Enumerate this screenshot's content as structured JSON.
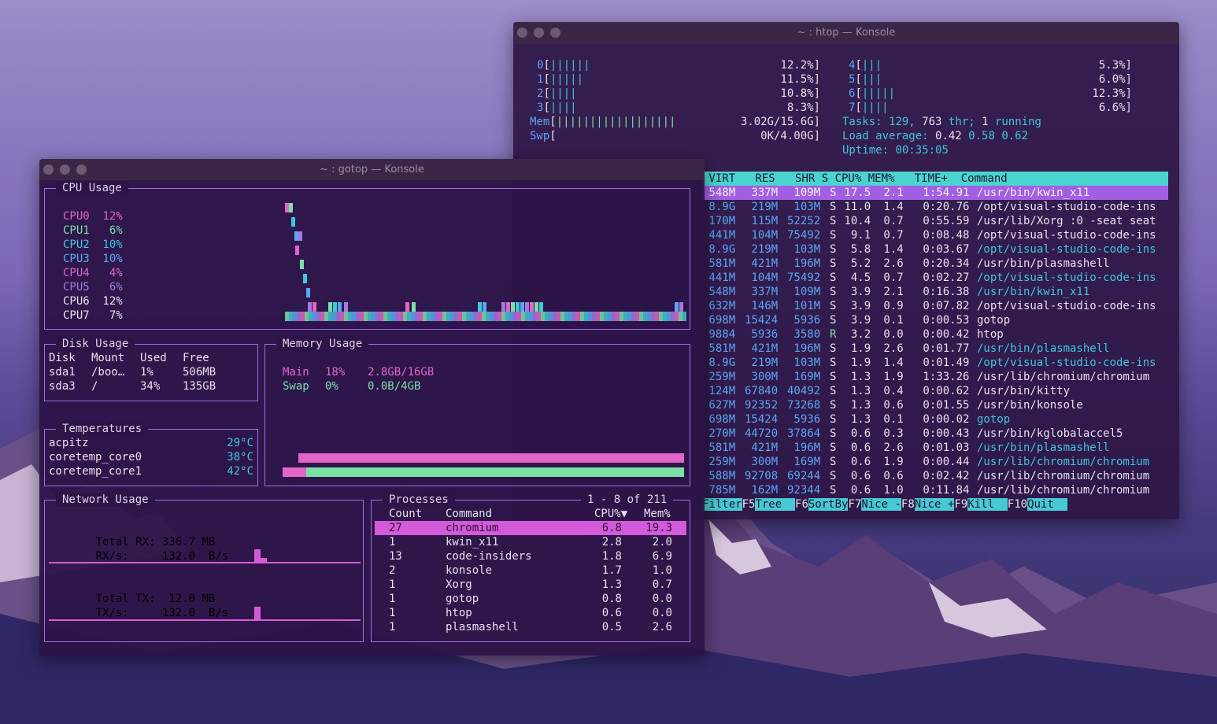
{
  "htop": {
    "title": "~ : htop — Konsole",
    "cpus_left": [
      {
        "id": "0",
        "bars": "||||||",
        "pct": "12.2%]"
      },
      {
        "id": "1",
        "bars": "|||||",
        "pct": "11.5%]"
      },
      {
        "id": "2",
        "bars": "||||",
        "pct": "10.8%]"
      },
      {
        "id": "3",
        "bars": "||||",
        "pct": "8.3%]"
      }
    ],
    "cpus_right": [
      {
        "id": "4",
        "bars": "|||",
        "pct": "5.3%]"
      },
      {
        "id": "5",
        "bars": "|||",
        "pct": "6.0%]"
      },
      {
        "id": "6",
        "bars": "|||||",
        "pct": "12.3%]"
      },
      {
        "id": "7",
        "bars": "||||",
        "pct": "6.6%]"
      }
    ],
    "mem": {
      "label": "Mem",
      "bars": "||||||||||||||||||",
      "value": "3.02G/15.6G]"
    },
    "swp": {
      "label": "Swp",
      "value": "0K/4.00G]"
    },
    "tasks": {
      "label": "Tasks:",
      "count": "129,",
      "thr": "763",
      "thr_label": "thr;",
      "running": "1",
      "running_label": "running"
    },
    "load": {
      "label": "Load average:",
      "v1": "0.42",
      "v2": "0.58",
      "v3": "0.62"
    },
    "uptime": {
      "label": "Uptime:",
      "value": "00:35:05"
    },
    "header": " VIRT   RES   SHR S CPU% MEM%   TIME+  Command",
    "rows": [
      {
        "virt": "548M",
        "res": "337M",
        "shr": "109M",
        "s": "S",
        "cpu": "17.5",
        "mem": "2.1",
        "time": "1:54.91",
        "cmd": "/usr/bin/kwin_x11",
        "sel": true
      },
      {
        "virt": "8.9G",
        "res": "219M",
        "shr": "103M",
        "s": "S",
        "cpu": "11.0",
        "mem": "1.4",
        "time": "0:20.76",
        "cmd": "/opt/visual-studio-code-ins"
      },
      {
        "virt": "170M",
        "res": "115M",
        "shr": "52252",
        "s": "S",
        "cpu": "10.4",
        "mem": "0.7",
        "time": "0:55.59",
        "cmd": "/usr/lib/Xorg :0 -seat seat"
      },
      {
        "virt": "441M",
        "res": "104M",
        "shr": "75492",
        "s": "S",
        "cpu": "9.1",
        "mem": "0.7",
        "time": "0:08.48",
        "cmd": "/opt/visual-studio-code-ins"
      },
      {
        "virt": "8.9G",
        "res": "219M",
        "shr": "103M",
        "s": "S",
        "cpu": "5.8",
        "mem": "1.4",
        "time": "0:03.67",
        "cmd": "/opt/visual-studio-code-ins",
        "thread": true
      },
      {
        "virt": "581M",
        "res": "421M",
        "shr": "196M",
        "s": "S",
        "cpu": "5.2",
        "mem": "2.6",
        "time": "0:20.34",
        "cmd": "/usr/bin/plasmashell"
      },
      {
        "virt": "441M",
        "res": "104M",
        "shr": "75492",
        "s": "S",
        "cpu": "4.5",
        "mem": "0.7",
        "time": "0:02.27",
        "cmd": "/opt/visual-studio-code-ins",
        "thread": true
      },
      {
        "virt": "548M",
        "res": "337M",
        "shr": "109M",
        "s": "S",
        "cpu": "3.9",
        "mem": "2.1",
        "time": "0:16.38",
        "cmd": "/usr/bin/kwin_x11",
        "thread": true
      },
      {
        "virt": "632M",
        "res": "146M",
        "shr": "101M",
        "s": "S",
        "cpu": "3.9",
        "mem": "0.9",
        "time": "0:07.82",
        "cmd": "/opt/visual-studio-code-ins"
      },
      {
        "virt": "698M",
        "res": "15424",
        "shr": "5936",
        "s": "S",
        "cpu": "3.9",
        "mem": "0.1",
        "time": "0:00.53",
        "cmd": "gotop"
      },
      {
        "virt": "9884",
        "res": "5936",
        "shr": "3580",
        "s": "R",
        "cpu": "3.2",
        "mem": "0.0",
        "time": "0:00.42",
        "cmd": "htop"
      },
      {
        "virt": "581M",
        "res": "421M",
        "shr": "196M",
        "s": "S",
        "cpu": "1.9",
        "mem": "2.6",
        "time": "0:01.77",
        "cmd": "/usr/bin/plasmashell",
        "thread": true
      },
      {
        "virt": "8.9G",
        "res": "219M",
        "shr": "103M",
        "s": "S",
        "cpu": "1.9",
        "mem": "1.4",
        "time": "0:01.49",
        "cmd": "/opt/visual-studio-code-ins",
        "thread": true
      },
      {
        "virt": "259M",
        "res": "300M",
        "shr": "169M",
        "s": "S",
        "cpu": "1.3",
        "mem": "1.9",
        "time": "1:33.26",
        "cmd": "/usr/lib/chromium/chromium"
      },
      {
        "virt": "124M",
        "res": "67840",
        "shr": "40492",
        "s": "S",
        "cpu": "1.3",
        "mem": "0.4",
        "time": "0:00.62",
        "cmd": "/usr/bin/kitty"
      },
      {
        "virt": "627M",
        "res": "92352",
        "shr": "73268",
        "s": "S",
        "cpu": "1.3",
        "mem": "0.6",
        "time": "0:01.55",
        "cmd": "/usr/bin/konsole"
      },
      {
        "virt": "698M",
        "res": "15424",
        "shr": "5936",
        "s": "S",
        "cpu": "1.3",
        "mem": "0.1",
        "time": "0:00.02",
        "cmd": "gotop",
        "thread": true
      },
      {
        "virt": "270M",
        "res": "44720",
        "shr": "37864",
        "s": "S",
        "cpu": "0.6",
        "mem": "0.3",
        "time": "0:00.43",
        "cmd": "/usr/bin/kglobalaccel5"
      },
      {
        "virt": "581M",
        "res": "421M",
        "shr": "196M",
        "s": "S",
        "cpu": "0.6",
        "mem": "2.6",
        "time": "0:01.03",
        "cmd": "/usr/bin/plasmashell",
        "thread": true
      },
      {
        "virt": "259M",
        "res": "300M",
        "shr": "169M",
        "s": "S",
        "cpu": "0.6",
        "mem": "1.9",
        "time": "0:00.44",
        "cmd": "/usr/lib/chromium/chromium",
        "thread": true
      },
      {
        "virt": "588M",
        "res": "92708",
        "shr": "69244",
        "s": "S",
        "cpu": "0.6",
        "mem": "0.6",
        "time": "0:02.42",
        "cmd": "/usr/lib/chromium/chromium"
      },
      {
        "virt": "785M",
        "res": "162M",
        "shr": "92344",
        "s": "S",
        "cpu": "0.6",
        "mem": "1.0",
        "time": "0:11.84",
        "cmd": "/usr/lib/chromium/chromium"
      }
    ],
    "fkeys": [
      {
        "key": "",
        "label": "Filter"
      },
      {
        "key": "F5",
        "label": "Tree  "
      },
      {
        "key": "F6",
        "label": "SortBy"
      },
      {
        "key": "F7",
        "label": "Nice -"
      },
      {
        "key": "F8",
        "label": "Nice +"
      },
      {
        "key": "F9",
        "label": "Kill  "
      },
      {
        "key": "F10",
        "label": "Quit  "
      }
    ]
  },
  "gotop": {
    "title": "~ : gotop — Konsole",
    "cpu_title": "CPU Usage",
    "cpus": [
      {
        "name": "CPU0",
        "pct": "12%",
        "color": "#e265c8"
      },
      {
        "name": "CPU1",
        "pct": "6%",
        "color": "#7be0a4"
      },
      {
        "name": "CPU2",
        "pct": "10%",
        "color": "#3ec8d8"
      },
      {
        "name": "CPU3",
        "pct": "10%",
        "color": "#5aa8f2"
      },
      {
        "name": "CPU4",
        "pct": "4%",
        "color": "#e265c8"
      },
      {
        "name": "CPU5",
        "pct": "6%",
        "color": "#a479e3"
      },
      {
        "name": "CPU6",
        "pct": "12%",
        "color": "#e8e0ee"
      },
      {
        "name": "CPU7",
        "pct": "7%",
        "color": "#e8e0ee"
      }
    ],
    "disk_title": "Disk Usage",
    "disk_header": [
      "Disk",
      "Mount",
      "Used",
      "Free"
    ],
    "disks": [
      [
        "sda1",
        "/boo…",
        "1%",
        "506MB"
      ],
      [
        "sda3",
        "/",
        "34%",
        "135GB"
      ]
    ],
    "mem_title": "Memory Usage",
    "mem_rows": [
      {
        "name": "Main",
        "pct": "18%",
        "val": "2.8GB/16GB",
        "color": "#e265c8"
      },
      {
        "name": "Swap",
        "pct": "0%",
        "val": "0.0B/4GB",
        "color": "#7be0a4"
      }
    ],
    "temp_title": "Temperatures",
    "temps": [
      [
        "acpitz",
        "29°C"
      ],
      [
        "coretemp_core0",
        "38°C"
      ],
      [
        "coretemp_core1",
        "42°C"
      ]
    ],
    "net_title": "Network Usage",
    "net": {
      "rx_total_label": "Total RX:",
      "rx_total": "336.7 MB",
      "rx_rate_label": "RX/s:",
      "rx_rate": "132.0  B/s",
      "tx_total_label": "Total TX:",
      "tx_total": "12.0 MB",
      "tx_rate_label": "TX/s:",
      "tx_rate": "132.0  B/s"
    },
    "proc_title": "Processes",
    "proc_range": "1 - 8 of 211",
    "proc_header": [
      "Count",
      "Command",
      "CPU%▼",
      "Mem%"
    ],
    "procs": [
      [
        "27",
        "chromium",
        "6.8",
        "19.3"
      ],
      [
        "1",
        "kwin_x11",
        "2.8",
        "2.0"
      ],
      [
        "13",
        "code-insiders",
        "1.8",
        "6.9"
      ],
      [
        "2",
        "konsole",
        "1.7",
        "1.0"
      ],
      [
        "1",
        "Xorg",
        "1.3",
        "0.7"
      ],
      [
        "1",
        "gotop",
        "0.8",
        "0.0"
      ],
      [
        "1",
        "htop",
        "0.6",
        "0.0"
      ],
      [
        "1",
        "plasmashell",
        "0.5",
        "2.6"
      ]
    ]
  },
  "colors": {
    "accent": "#a56be0",
    "pink": "#e265c8",
    "cyan": "#3ec8d8",
    "green": "#7be0a4",
    "blue": "#5aa8f2",
    "violet": "#a479e3"
  }
}
